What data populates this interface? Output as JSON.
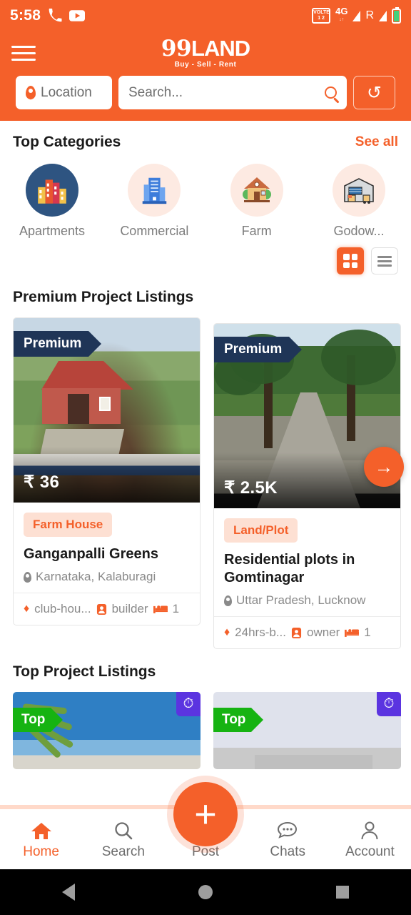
{
  "status_bar": {
    "time": "5:58",
    "left_icons": [
      "missed-call-icon",
      "youtube-icon"
    ],
    "volte_label": "VOLTE",
    "volte_sim": "1 2",
    "network": "4G",
    "network_sub": "↓↑",
    "roaming_letter": "R",
    "right_icons": [
      "signal-icon",
      "roaming-icon",
      "signal-2-icon",
      "battery-icon"
    ]
  },
  "header": {
    "menu_icon": "hamburger-icon",
    "logo_main": "99LAND",
    "logo_prefix": "99",
    "logo_suffix": "LAND",
    "logo_tagline": "Buy - Sell - Rent",
    "location_label": "Location",
    "search_placeholder": "Search...",
    "search_value": "",
    "search_icon": "magnifier-icon",
    "refresh_icon": "refresh-icon"
  },
  "categories_section": {
    "title": "Top Categories",
    "see_all": "See all",
    "items": [
      {
        "label": "Apartments",
        "icon": "apartment-buildings-icon",
        "glyph": "🏢"
      },
      {
        "label": "Commercial",
        "icon": "office-building-icon",
        "glyph": "🏢"
      },
      {
        "label": "Farm",
        "icon": "farm-house-icon",
        "glyph": "🏡"
      },
      {
        "label": "Godow...",
        "icon": "warehouse-icon",
        "glyph": "🏭"
      }
    ],
    "view_toggle": {
      "grid_icon": "grid-view-icon",
      "list_icon": "list-view-icon",
      "active": "grid"
    }
  },
  "premium_section": {
    "title": "Premium Project Listings",
    "next_arrow_icon": "arrow-right-icon",
    "cards": [
      {
        "badge": "Premium",
        "price": "₹ 36",
        "tag": "Farm House",
        "title": "Ganganpalli Greens",
        "location": "Karnataka, Kalaburagi",
        "amenity": "club-hou...",
        "amenity_icon": "diamond-icon",
        "poster": "builder",
        "poster_icon": "user-badge-icon",
        "beds": "1",
        "beds_icon": "bed-icon"
      },
      {
        "badge": "Premium",
        "price": "₹ 2.5K",
        "tag": "Land/Plot",
        "title": "Residential plots in Gomtinagar",
        "location": "Uttar Pradesh, Lucknow",
        "amenity": "24hrs-b...",
        "amenity_icon": "diamond-icon",
        "poster": "owner",
        "poster_icon": "user-badge-icon",
        "beds": "1",
        "beds_icon": "bed-icon"
      }
    ]
  },
  "top_section": {
    "title": "Top Project Listings",
    "cards": [
      {
        "badge": "Top",
        "clock_icon": "clock-icon"
      },
      {
        "badge": "Top",
        "clock_icon": "clock-icon"
      }
    ]
  },
  "fab": {
    "icon": "plus-icon",
    "label": "+"
  },
  "bottom_nav": {
    "items": [
      {
        "label": "Home",
        "icon": "home-icon",
        "glyph": "⌂",
        "active": true
      },
      {
        "label": "Search",
        "icon": "search-icon",
        "glyph": "⚲",
        "active": false
      },
      {
        "label": "Post",
        "icon": "post-icon",
        "glyph": "",
        "active": false
      },
      {
        "label": "Chats",
        "icon": "chat-bubble-icon",
        "glyph": "●",
        "active": false
      },
      {
        "label": "Account",
        "icon": "person-icon",
        "glyph": "●",
        "active": false
      }
    ]
  },
  "system_nav": {
    "back": "back-icon",
    "home": "home-circle-icon",
    "recents": "recents-icon"
  },
  "colors": {
    "brand": "#f4602a",
    "premium_badge": "#1f3557",
    "top_badge": "#16b312",
    "clock_badge": "#5b34e0",
    "tag_bg": "#fde0d3"
  }
}
